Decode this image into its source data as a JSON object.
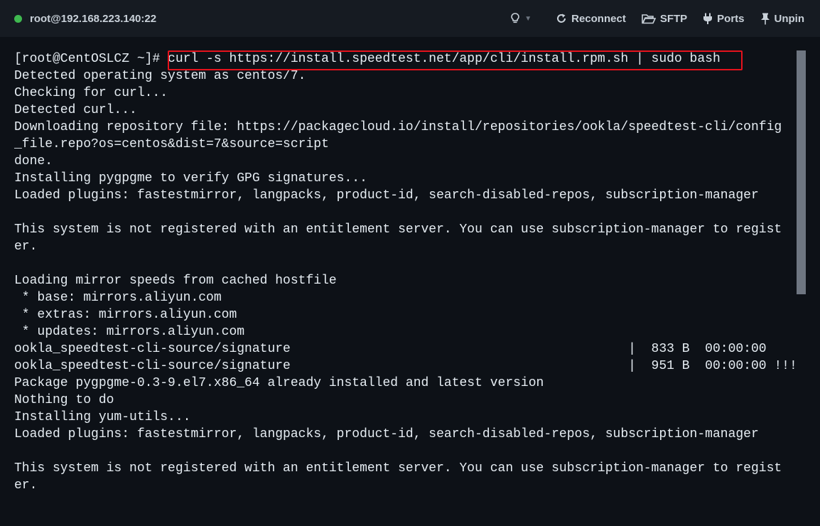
{
  "titlebar": {
    "connection": "root@192.168.223.140:22",
    "status_color": "#3fb950",
    "buttons": {
      "reconnect": "Reconnect",
      "sftp": "SFTP",
      "ports": "Ports",
      "unpin": "Unpin"
    },
    "icons": {
      "lightbulb": "lightbulb-icon",
      "reconnect": "refresh-icon",
      "sftp": "folder-open-icon",
      "ports": "plug-icon",
      "unpin": "pin-icon"
    }
  },
  "terminal": {
    "highlight_color": "#e5121c",
    "lines": [
      "[root@CentOSLCZ ~]# curl -s https://install.speedtest.net/app/cli/install.rpm.sh | sudo bash",
      "Detected operating system as centos/7.",
      "Checking for curl...",
      "Detected curl...",
      "Downloading repository file: https://packagecloud.io/install/repositories/ookla/speedtest-cli/config",
      "_file.repo?os=centos&dist=7&source=script",
      "done.",
      "Installing pygpgme to verify GPG signatures...",
      "Loaded plugins: fastestmirror, langpacks, product-id, search-disabled-repos, subscription-manager",
      "",
      "This system is not registered with an entitlement server. You can use subscription-manager to regist",
      "er.",
      "",
      "Loading mirror speeds from cached hostfile",
      " * base: mirrors.aliyun.com",
      " * extras: mirrors.aliyun.com",
      " * updates: mirrors.aliyun.com",
      "ookla_speedtest-cli-source/signature                                            |  833 B  00:00:00",
      "ookla_speedtest-cli-source/signature                                            |  951 B  00:00:00 !!!",
      "Package pygpgme-0.3-9.el7.x86_64 already installed and latest version",
      "Nothing to do",
      "Installing yum-utils...",
      "Loaded plugins: fastestmirror, langpacks, product-id, search-disabled-repos, subscription-manager",
      "",
      "This system is not registered with an entitlement server. You can use subscription-manager to regist",
      "er."
    ]
  }
}
